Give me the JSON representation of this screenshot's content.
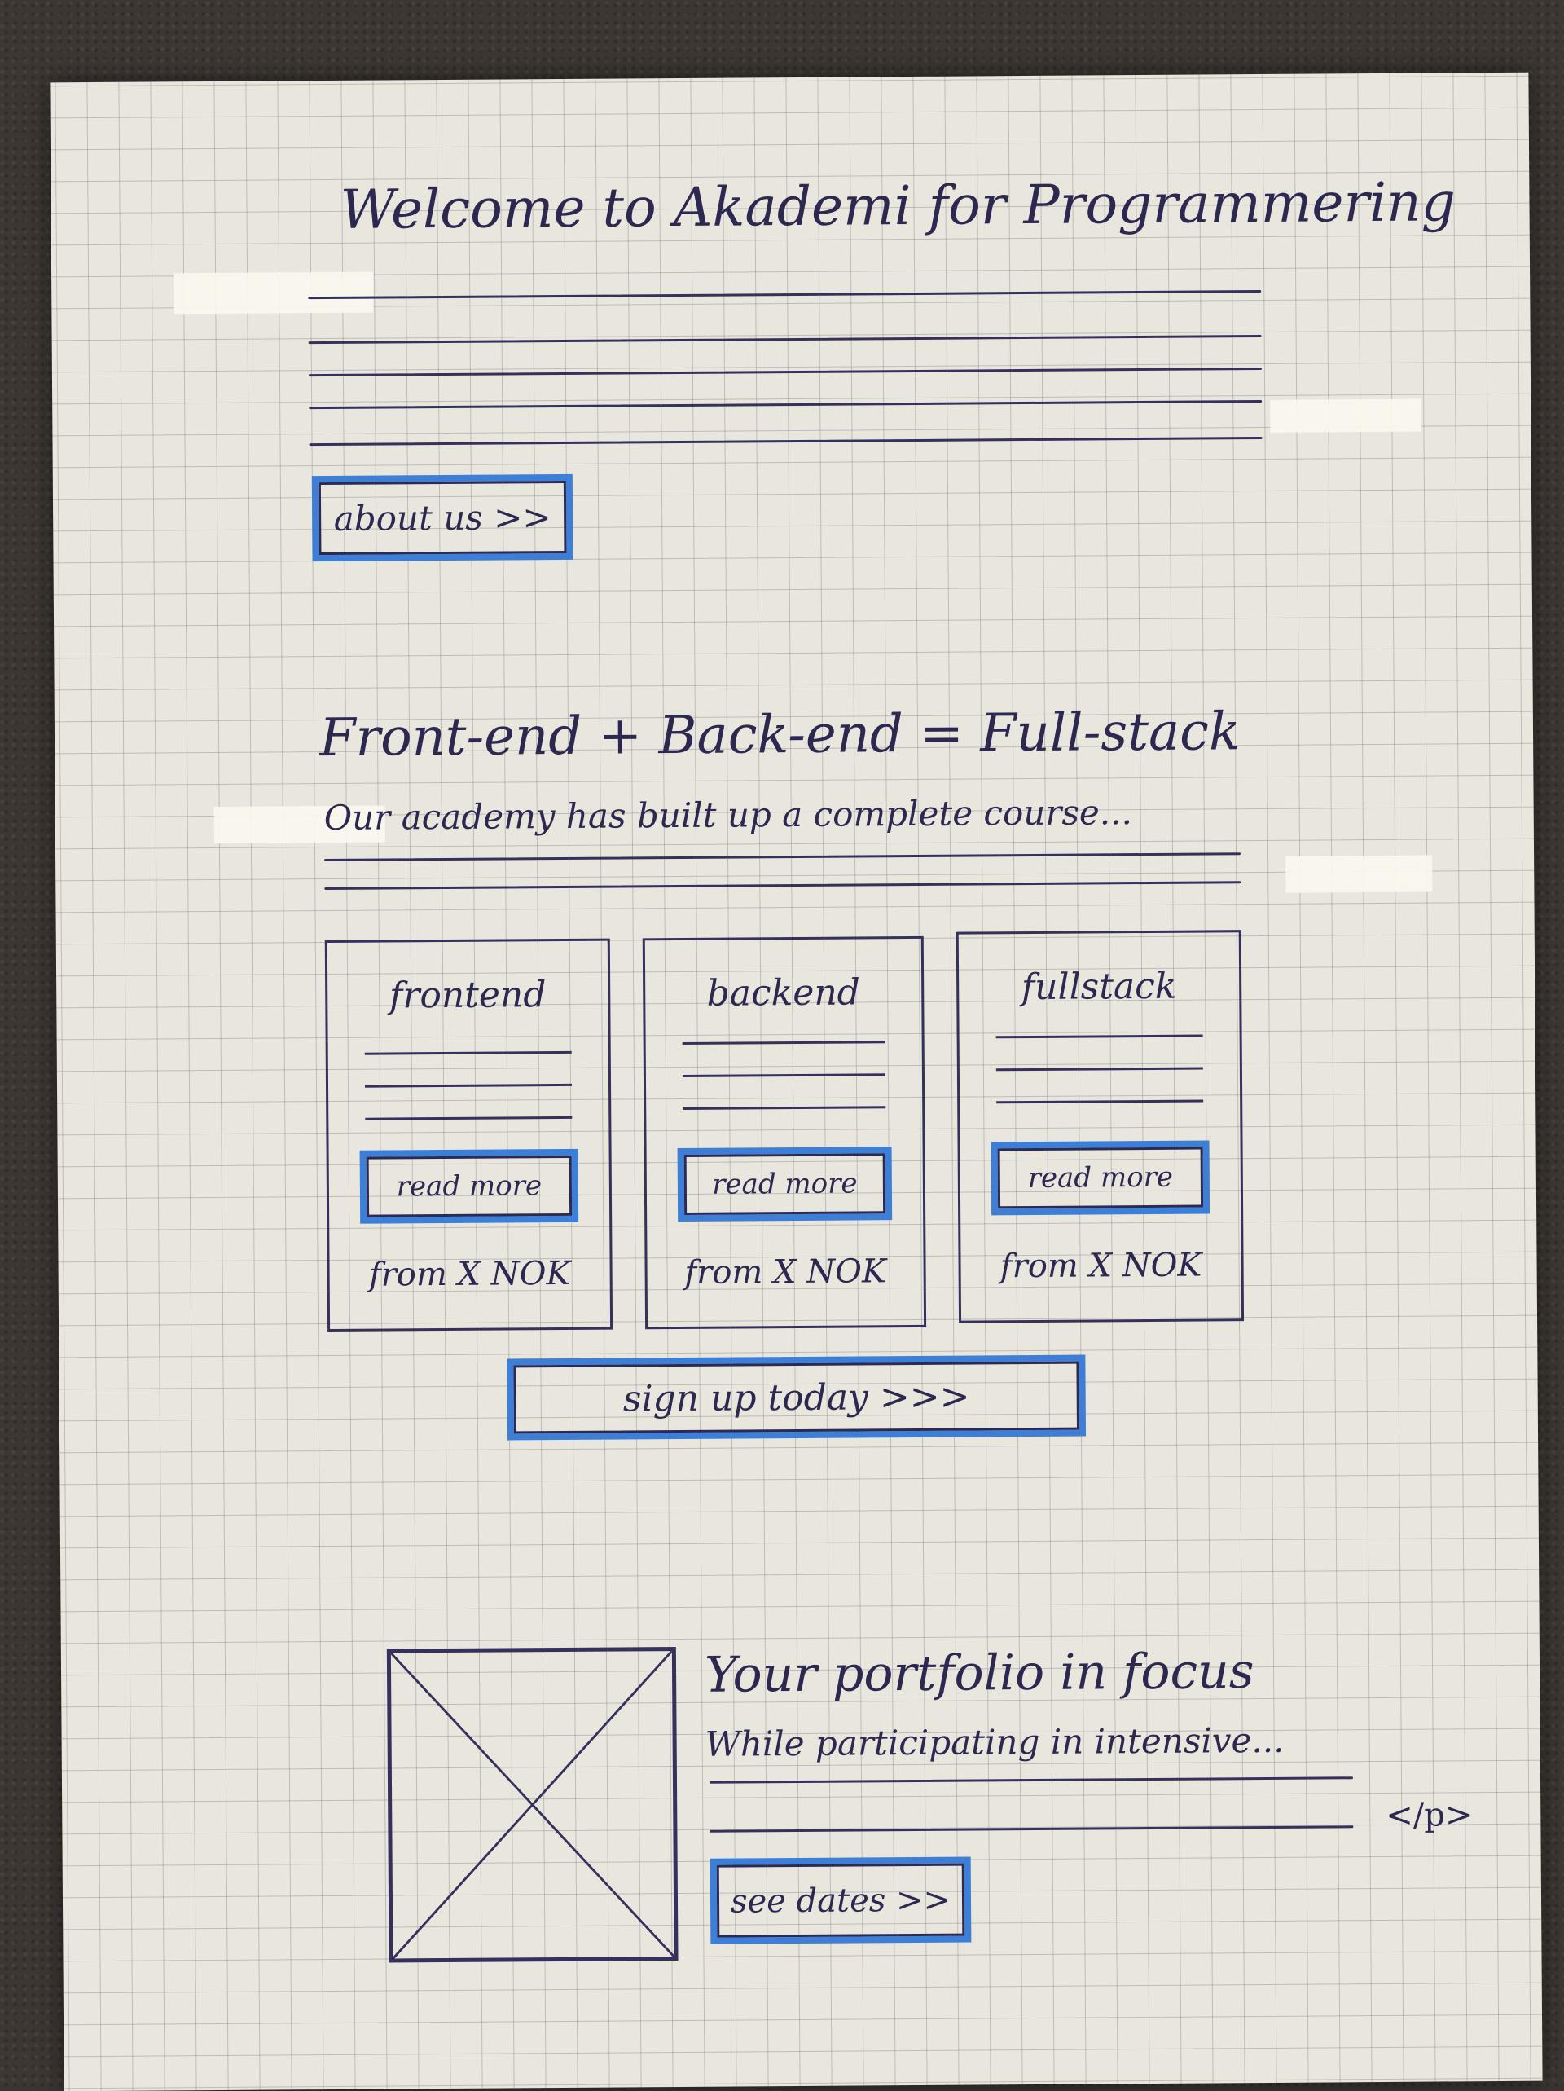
{
  "hero": {
    "title": "Welcome to Akademi for Programmering",
    "button_label": "about us >>"
  },
  "courses_section": {
    "heading": "Front-end + Back-end = Full-stack",
    "intro": "Our academy has built up a complete course...",
    "cards": [
      {
        "title": "frontend",
        "button_label": "read more",
        "price": "from X NOK"
      },
      {
        "title": "backend",
        "button_label": "read more",
        "price": "from X NOK"
      },
      {
        "title": "fullstack",
        "button_label": "read more",
        "price": "from X NOK"
      }
    ],
    "signup_label": "sign up today >>>"
  },
  "portfolio_section": {
    "heading": "Your portfolio in focus",
    "intro": "While participating in intensive...",
    "closing_tag": "</p>",
    "button_label": "see dates >>"
  },
  "colors": {
    "ink": "#2c2850",
    "button_highlight": "#3d7fd6",
    "paper": "#e9e6dd"
  }
}
